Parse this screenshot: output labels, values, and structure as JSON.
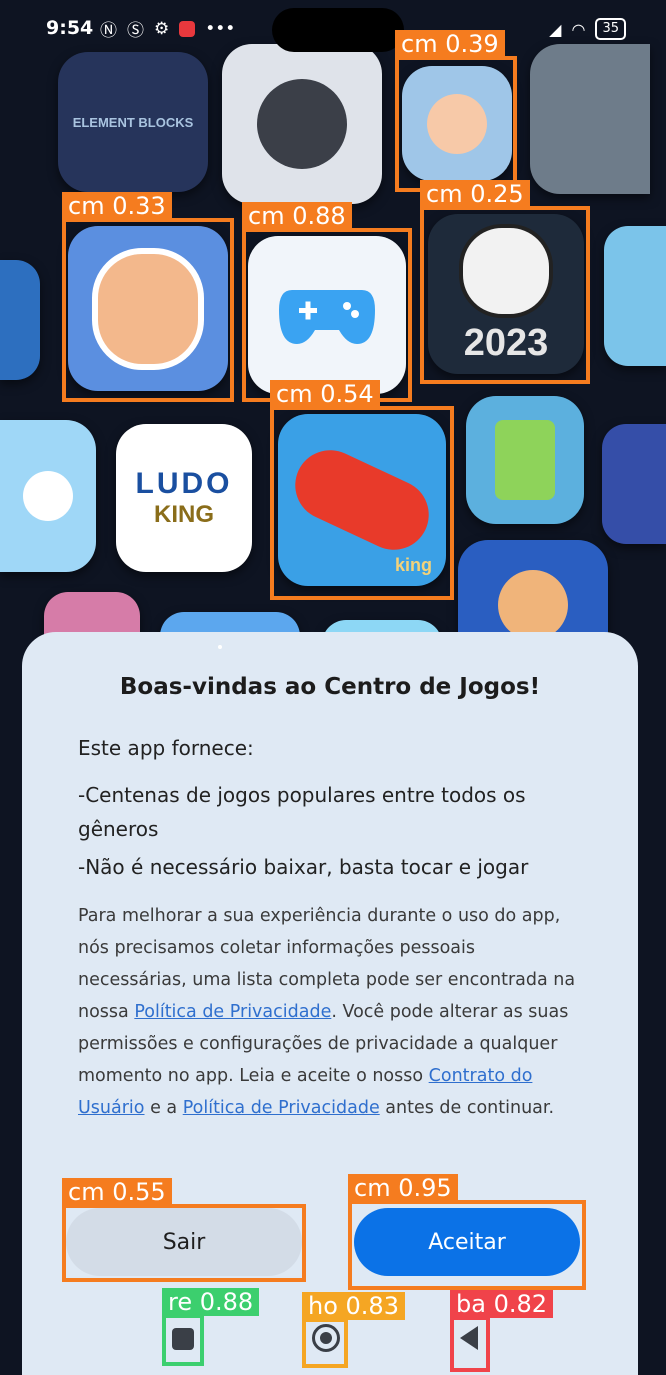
{
  "status_bar": {
    "time": "9:54",
    "battery": "35"
  },
  "dialog": {
    "title": "Boas-vindas ao Centro de Jogos!",
    "provides": "Este app fornece:",
    "feature1": "-Centenas de jogos populares entre todos os gêneros",
    "feature2": "-Não é necessário baixar, basta tocar e jogar",
    "body_part1": "Para melhorar a sua experiência durante o uso do app, nós precisamos coletar informações pessoais necessárias, uma lista completa pode ser encontrada na nossa ",
    "privacy_link_1": "Política de Privacidade",
    "body_part2": ". Você pode alterar as suas permissões e configurações de privacidade a qualquer momento no app. Leia e aceite o nosso ",
    "user_agreement_link": "Contrato do Usuário",
    "body_part3": " e a ",
    "privacy_link_2": "Política de Privacidade",
    "body_part4": " antes de continuar.",
    "exit_button": "Sair",
    "accept_button": "Aceitar"
  },
  "background_tiles": {
    "element_blocks": "ELEMENT BLOCKS",
    "ludo_top": "LUDO",
    "ludo_bottom": "KING",
    "soccer_year": "2023",
    "candy_brand": "king"
  },
  "detections": {
    "d1": "cm 0.39",
    "d2": "cm 0.33",
    "d3": "cm 0.88",
    "d4": "cm 0.25",
    "d5": "cm 0.54",
    "d6": "cm 0.55",
    "d7": "cm 0.95",
    "d8": "re 0.88",
    "d9": "ho 0.83",
    "d10": "ba 0.82"
  },
  "colors": {
    "accent": "#0b72e7",
    "dialog_bg": "#dfe9f4",
    "detection_orange": "#f57c1f"
  }
}
